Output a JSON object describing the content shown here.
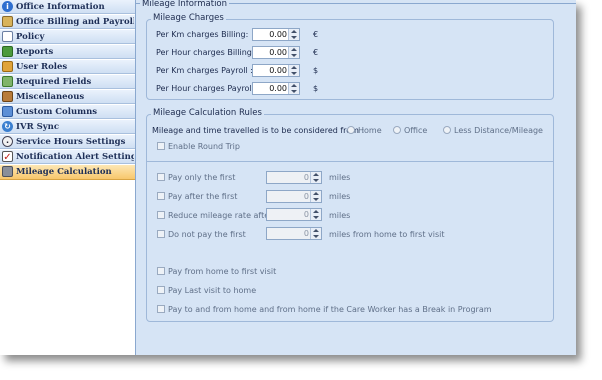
{
  "sidebar": {
    "items": [
      {
        "label": "Office Information",
        "icon": "info-icon"
      },
      {
        "label": "Office Billing and Payroll Pol...",
        "icon": "billing-icon"
      },
      {
        "label": "Policy",
        "icon": "policy-icon"
      },
      {
        "label": "Reports",
        "icon": "reports-icon"
      },
      {
        "label": "User Roles",
        "icon": "user-roles-icon"
      },
      {
        "label": "Required Fields",
        "icon": "required-fields-icon"
      },
      {
        "label": "Miscellaneous",
        "icon": "miscellaneous-icon"
      },
      {
        "label": "Custom Columns",
        "icon": "custom-columns-icon"
      },
      {
        "label": "IVR Sync",
        "icon": "ivr-sync-icon"
      },
      {
        "label": "Service Hours Settings",
        "icon": "clock-icon"
      },
      {
        "label": "Notification Alert Settings",
        "icon": "alert-checkmark-icon"
      },
      {
        "label": "Mileage Calculation",
        "icon": "mileage-icon"
      }
    ],
    "active_index": 11
  },
  "main": {
    "section_title": "Mileage Information",
    "charges": {
      "title": "Mileage Charges",
      "rows": [
        {
          "label": "Per Km charges Billing:",
          "value": "0.00",
          "unit": "€"
        },
        {
          "label": "Per Hour charges Billing :",
          "value": "0.00",
          "unit": "€"
        },
        {
          "label": "Per Km charges Payroll :",
          "value": "0.00",
          "unit": "$"
        },
        {
          "label": "Per Hour charges Payroll :",
          "value": "0.00",
          "unit": "$"
        }
      ]
    },
    "rules": {
      "title": "Mileage Calculation Rules",
      "consider_label": "Mileage and time travelled is to be considered from :",
      "options": [
        "Home",
        "Office",
        "Less Distance/Mileage"
      ],
      "round_trip": "Enable Round Trip",
      "limits": [
        {
          "label": "Pay only the first",
          "value": "0",
          "suffix": "miles"
        },
        {
          "label": "Pay after the first",
          "value": "0",
          "suffix": "miles"
        },
        {
          "label": "Reduce mileage rate  after",
          "value": "0",
          "suffix": "miles"
        },
        {
          "label": "Do not pay the first",
          "value": "0",
          "suffix": "miles from home to first visit"
        }
      ],
      "pay_options": [
        "Pay from home to first visit",
        "Pay Last visit to home",
        "Pay to and from home and from home if the Care Worker has a Break in Program"
      ]
    }
  },
  "colors": {
    "panel_bg": "#d6e4f5",
    "active_nav": "#f8c76c",
    "nav_text": "#1e2f57"
  }
}
